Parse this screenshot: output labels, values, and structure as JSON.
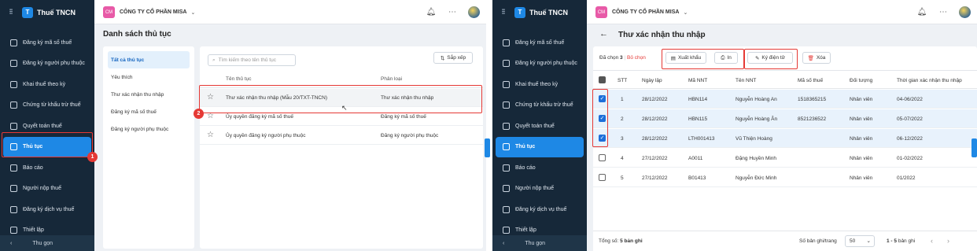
{
  "app_title": "Thuế TNCN",
  "company": {
    "badge": "CM",
    "name": "CÔNG TY CỔ PHẦN MISA"
  },
  "sidebar": {
    "items": [
      "Đăng ký mã số thuế",
      "Đăng ký người phụ thuộc",
      "Khai thuế theo kỳ",
      "Chứng từ khấu trừ thuế",
      "Quyết toán thuế",
      "Thủ tục",
      "Báo cáo",
      "Người nộp thuế",
      "Đăng ký dịch vụ thuế",
      "Thiết lập"
    ],
    "collapse_label": "Thu gọn"
  },
  "left": {
    "title": "Danh sách thủ tục",
    "categories": [
      "Tất cả thủ tục",
      "Yêu thích",
      "Thư xác nhận thu nhập",
      "Đăng ký mã số thuế",
      "Đăng ký người phụ thuộc"
    ],
    "search_placeholder": "Tìm kiếm theo tên thủ tục",
    "sort_label": "Sắp xếp",
    "col_name": "Tên thủ tục",
    "col_type": "Phân loại",
    "rows": [
      {
        "name": "Thư xác nhận thu nhập (Mẫu 20/TXT-TNCN)",
        "type": "Thư xác nhận thu nhập"
      },
      {
        "name": "Ủy quyền đăng ký mã số thuế",
        "type": "Đăng ký mã số thuế"
      },
      {
        "name": "Ủy quyền đăng ký người phụ thuộc",
        "type": "Đăng ký người phụ thuộc"
      }
    ],
    "badge1": "1",
    "badge2": "2"
  },
  "right": {
    "title": "Thư xác nhận thu nhập",
    "selected_label": "Đã chọn",
    "selected_count": "3",
    "deselect": "Bỏ chọn",
    "export": "Xuất khẩu",
    "print": "In",
    "sign": "Ký điện tử",
    "delete": "Xóa",
    "headers": {
      "stt": "STT",
      "date": "Ngày lập",
      "code": "Mã NNT",
      "name": "Tên NNT",
      "tax": "Mã số thuế",
      "obj": "Đối tượng",
      "period": "Thời gian xác nhận thu nhập"
    },
    "rows": [
      {
        "stt": "1",
        "date": "28/12/2022",
        "code": "HBN114",
        "name": "Nguyễn Hoàng An",
        "tax": "1518365215",
        "obj": "Nhân viên",
        "period": "04-06/2022",
        "checked": true
      },
      {
        "stt": "2",
        "date": "28/12/2022",
        "code": "HBN115",
        "name": "Nguyễn Hoàng Ân",
        "tax": "8521236522",
        "obj": "Nhân viên",
        "period": "05-07/2022",
        "checked": true
      },
      {
        "stt": "3",
        "date": "28/12/2022",
        "code": "LTH001413",
        "name": "Vũ Thiện Hoàng",
        "tax": "",
        "obj": "Nhân viên",
        "period": "06-12/2022",
        "checked": true
      },
      {
        "stt": "4",
        "date": "27/12/2022",
        "code": "A0011",
        "name": "Đặng Huyền Minh",
        "tax": "",
        "obj": "Nhân viên",
        "period": "01-02/2022",
        "checked": false
      },
      {
        "stt": "5",
        "date": "27/12/2022",
        "code": "B01413",
        "name": "Nguyễn Đức Minh",
        "tax": "",
        "obj": "Nhân viên",
        "period": "01/2022",
        "checked": false
      }
    ],
    "total_label": "Tổng số:",
    "total_value": "5 bản ghi",
    "per_page_label": "Số bản ghi/trang",
    "per_page": "50",
    "range": "1 - 5",
    "range_suffix": "bản ghi"
  },
  "colors": {
    "accent": "#1e88e5",
    "sidebar": "#162839",
    "highlight": "#e53935"
  }
}
